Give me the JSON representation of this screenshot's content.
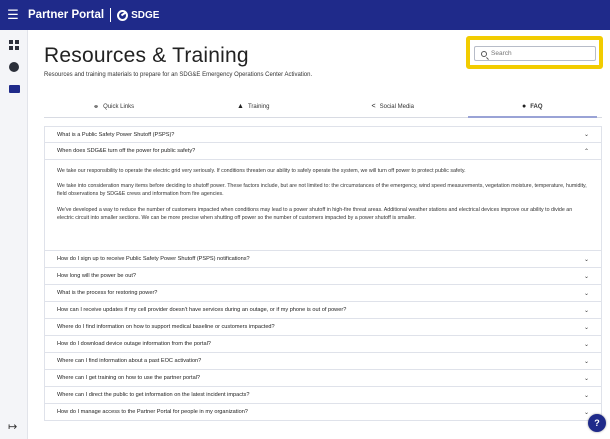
{
  "topbar": {
    "title": "Partner Portal",
    "logo_text": "SDGE"
  },
  "header": {
    "title": "Resources & Training",
    "subtitle": "Resources and training materials to prepare for an SDG&E Emergency Operations Center Activation."
  },
  "search": {
    "placeholder": "Search"
  },
  "tabs": [
    {
      "label": "Quick Links",
      "icon": "link-icon"
    },
    {
      "label": "Training",
      "icon": "graduation-cap-icon"
    },
    {
      "label": "Social Media",
      "icon": "share-icon"
    },
    {
      "label": "FAQ",
      "icon": "info-icon",
      "active": true
    }
  ],
  "faq": {
    "q0": "What is a Public Safety Power Shutoff (PSPS)?",
    "q1": "When does SDG&E turn off the power for public safety?",
    "a1": [
      "We take our responsibility to operate the electric grid very seriously. If conditions threaten our ability to safely operate the system, we will turn off power to protect public safety.",
      "We take into consideration many items before deciding to shutoff power. These factors include, but are not limited to: the circumstances of the emergency, wind speed measurements, vegetation moisture, temperature, humidity, field observations by SDG&E crews and information from fire agencies.",
      "We've developed a way to reduce the number of customers impacted when conditions may lead to a power shutoff in high-fire threat areas. Additional weather stations and electrical devices improve our ability to divide an electric circuit into smaller sections. We can be more precise when shutting off power so the number of customers impacted by a power shutoff is smaller."
    ],
    "questions": [
      "How do I sign up to receive Public Safety Power Shutoff (PSPS) notifications?",
      "How long will the power be out?",
      "What is the process for restoring power?",
      "How can I receive updates if my cell provider doesn't have services during an outage, or if my phone is out of power?",
      "Where do I find information on how to support medical baseline or customers impacted?",
      "How do I download device outage information from the portal?",
      "Where can I find information about a past EOC activation?",
      "Where can I get training on how to use the partner portal?",
      "Where can I direct the public to get information on the latest incident impacts?",
      "How do I manage access to the Partner Portal for people in my organization?"
    ]
  },
  "help": {
    "label": "?"
  }
}
